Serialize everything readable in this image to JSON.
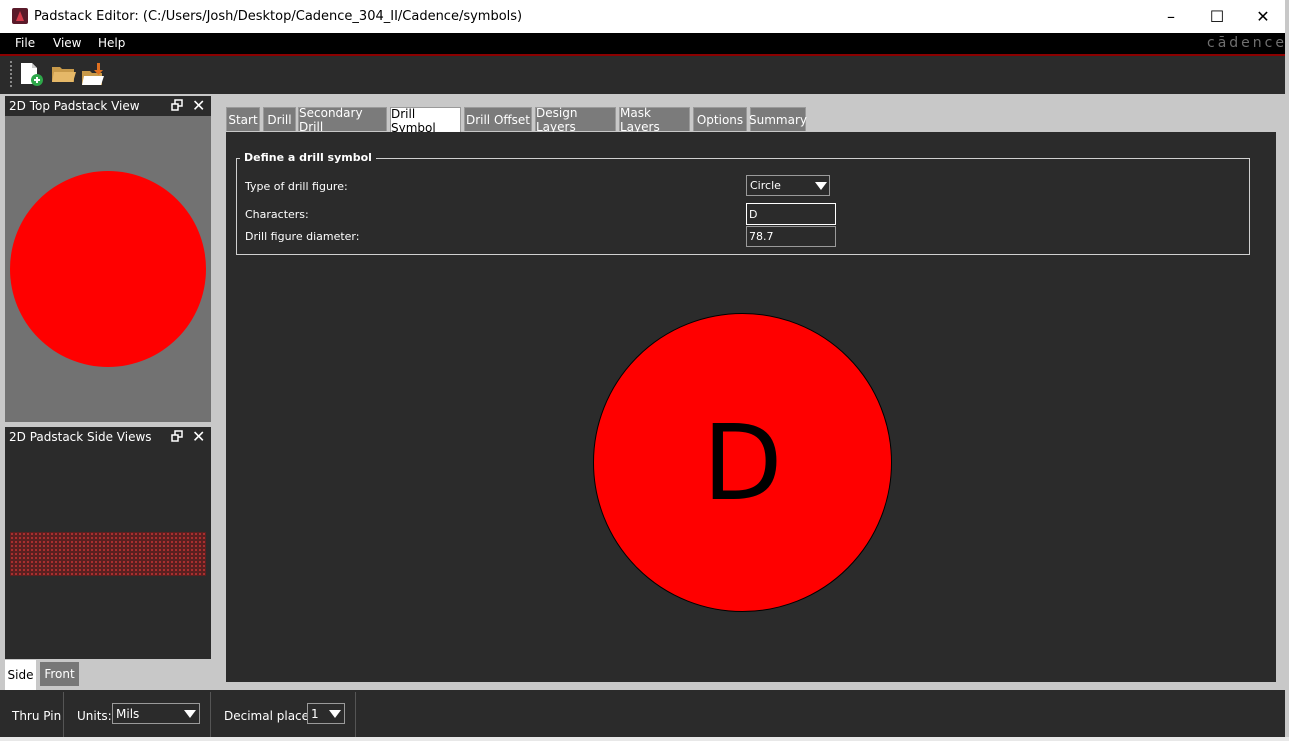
{
  "window": {
    "title": "Padstack Editor:  (C:/Users/Josh/Desktop/Cadence_304_II/Cadence/symbols)",
    "controls": {
      "minimize": "–",
      "maximize": "☐",
      "close": "✕"
    }
  },
  "menu": {
    "file": "File",
    "view": "View",
    "help": "Help",
    "brand": "cādence"
  },
  "toolbar": {
    "icons": [
      "new-file-icon",
      "open-folder-icon",
      "save-to-folder-icon"
    ]
  },
  "left_panels": {
    "top_view_title": "2D Top Padstack View",
    "side_view_title": "2D Padstack Side Views",
    "tabs": {
      "side": "Side",
      "front": "Front"
    }
  },
  "tabs": [
    {
      "label": "Start"
    },
    {
      "label": "Drill"
    },
    {
      "label": "Secondary Drill"
    },
    {
      "label": "Drill Symbol",
      "active": true
    },
    {
      "label": "Drill Offset"
    },
    {
      "label": "Design Layers"
    },
    {
      "label": "Mask Layers"
    },
    {
      "label": "Options"
    },
    {
      "label": "Summary"
    }
  ],
  "drill_symbol": {
    "group_title": "Define a drill symbol",
    "type_label": "Type of drill figure:",
    "type_value": "Circle",
    "characters_label": "Characters:",
    "characters_value": "D",
    "diameter_label": "Drill figure diameter:",
    "diameter_value": "78.7",
    "preview_character": "D"
  },
  "status": {
    "pin_type": "Thru Pin",
    "units_label": "Units:",
    "units_value": "Mils",
    "decimal_label": "Decimal places:",
    "decimal_value": "1"
  },
  "colors": {
    "drill_figure": "#ff0000",
    "background": "#2b2b2b",
    "accent": "#8b0000"
  }
}
